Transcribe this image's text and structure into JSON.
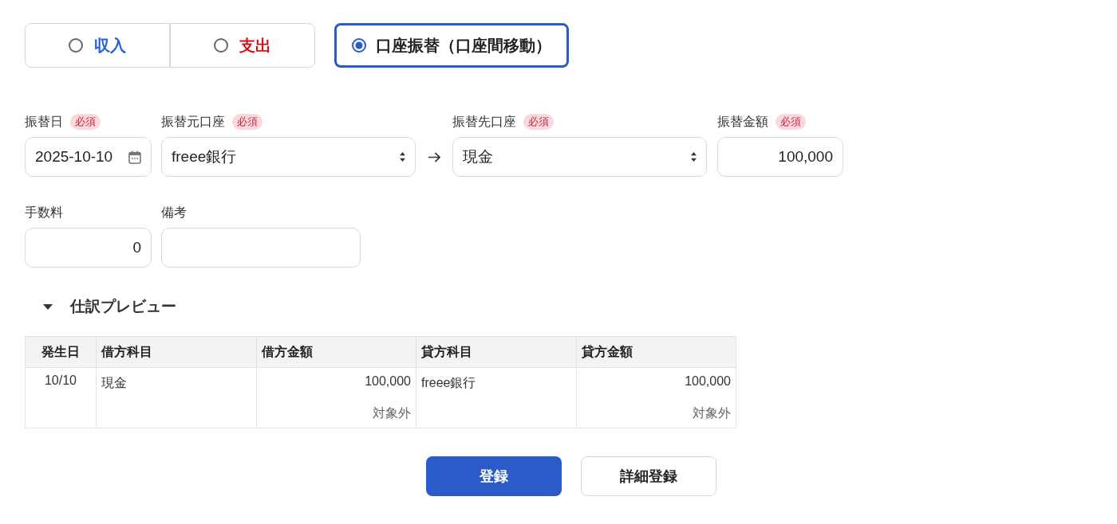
{
  "type_options": [
    {
      "label": "収入",
      "kind": "income",
      "selected": false
    },
    {
      "label": "支出",
      "kind": "expense",
      "selected": false
    },
    {
      "label": "口座振替（口座間移動）",
      "kind": "transfer",
      "selected": true
    }
  ],
  "transfer": {
    "date": {
      "label": "振替日",
      "badge": "必須",
      "value": "2025-10-10"
    },
    "from_account": {
      "label": "振替元口座",
      "badge": "必須",
      "value": "freee銀行"
    },
    "to_account": {
      "label": "振替先口座",
      "badge": "必須",
      "value": "現金"
    },
    "amount": {
      "label": "振替金額",
      "badge": "必須",
      "value": "100,000"
    }
  },
  "extra": {
    "fee": {
      "label": "手数料",
      "value": "0"
    },
    "memo": {
      "label": "備考"
    }
  },
  "journal_preview": {
    "title": "仕訳プレビュー",
    "expanded": true,
    "table": {
      "columns": [
        "発生日",
        "借方科目",
        "借方金額",
        "貸方科目",
        "貸方金額"
      ],
      "rows": [
        {
          "date": "10/10",
          "debit_account": "現金",
          "debit_amount": "100,000",
          "debit_tax": "対象外",
          "credit_account": "freee銀行",
          "credit_amount": "100,000",
          "credit_tax": "対象外"
        }
      ]
    }
  },
  "buttons": [
    {
      "label": "登録",
      "kind": "primary"
    },
    {
      "label": "詳細登録",
      "kind": "secondary"
    }
  ]
}
